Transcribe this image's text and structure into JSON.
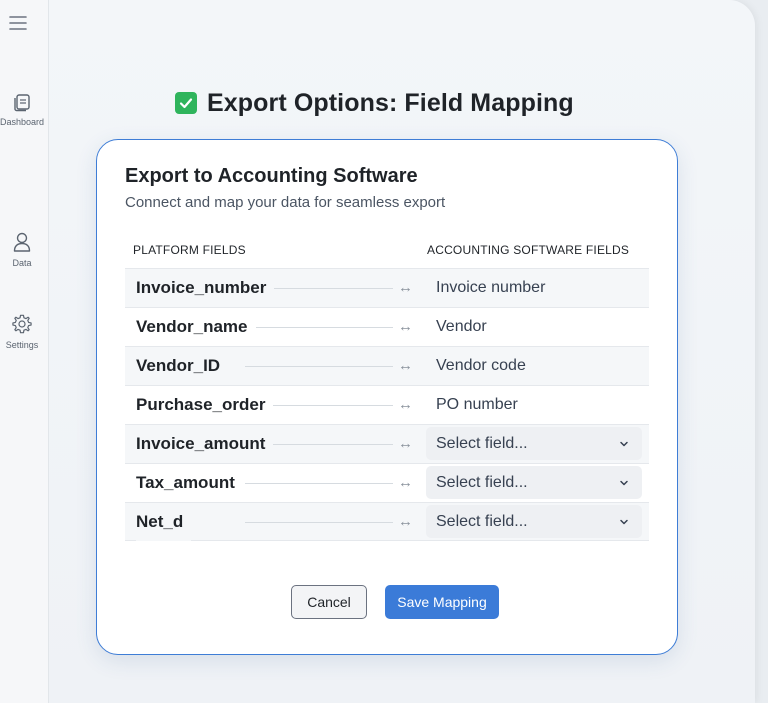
{
  "sidebar": {
    "items": [
      {
        "label": "Dashboard",
        "icon": "dashboard-icon"
      },
      {
        "label": "Data",
        "icon": "user-icon"
      },
      {
        "label": "Settings",
        "icon": "gear-icon"
      }
    ]
  },
  "page": {
    "title": "Export Options: Field Mapping",
    "title_icon": "check-box-icon"
  },
  "card": {
    "title": "Export to Accounting Software",
    "subtitle": "Connect and map your data for seamless export",
    "left_header": "PLATFORM FIELDS",
    "right_header": "ACCOUNTING SOFTWARE FIELDS",
    "rows": [
      {
        "field": "Invoice_number",
        "mapped": "Invoice number"
      },
      {
        "field": "Vendor_name",
        "mapped": "Vendor"
      },
      {
        "field": "Vendor_ID",
        "mapped": "Vendor code"
      },
      {
        "field": "Purchase_order",
        "mapped": "PO number"
      },
      {
        "field": "Invoice_amount",
        "select": "Select field..."
      },
      {
        "field": "Tax_amount",
        "select": "Select field..."
      },
      {
        "field": "Net_d",
        "select": "Select field..."
      }
    ],
    "arrow_glyph": "↔",
    "cancel_label": "Cancel",
    "save_label": "Save Mapping"
  },
  "colors": {
    "accent": "#3b7bd8",
    "card_border": "#3e7dd6",
    "check": "#2fb45c"
  }
}
